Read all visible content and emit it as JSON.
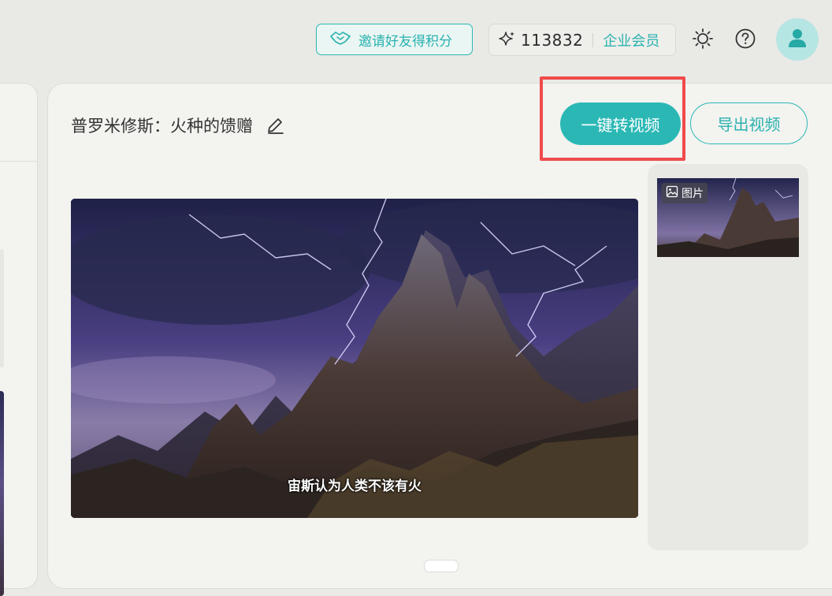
{
  "header": {
    "invite_label": "邀请好友得积分",
    "points": "113832",
    "membership_label": "企业会员"
  },
  "project": {
    "title": "普罗米修斯：火种的馈赠",
    "convert_button": "一键转视频",
    "export_button": "导出视频"
  },
  "preview": {
    "subtitle": "宙斯认为人类不该有火"
  },
  "thumbnails": [
    {
      "badge": "图片"
    }
  ],
  "colors": {
    "accent": "#2bb8b5",
    "highlight": "#f04b4b",
    "background": "#e9e9e5",
    "panel": "#f3f3f0"
  },
  "icons": [
    "handshake-icon",
    "sparkle-icon",
    "sun-icon",
    "help-icon",
    "user-icon",
    "edit-icon",
    "image-icon"
  ]
}
